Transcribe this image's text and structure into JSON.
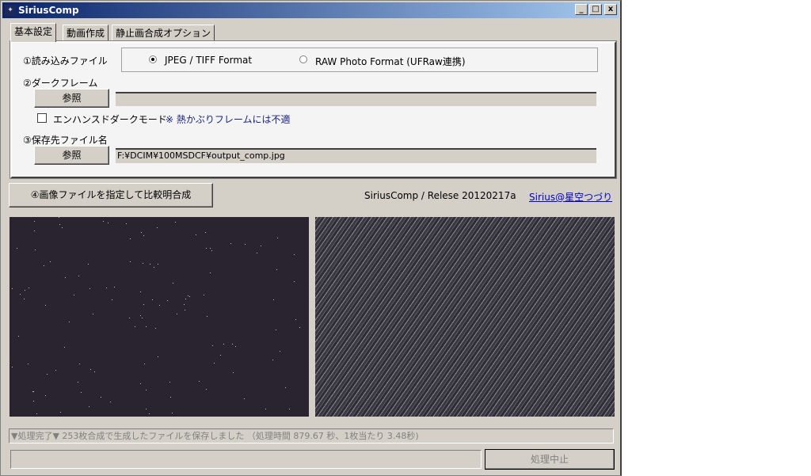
{
  "window": {
    "title": "SiriusComp",
    "minimize": "_",
    "maximize": "□",
    "close": "x"
  },
  "tabs": [
    {
      "label": "基本設定"
    },
    {
      "label": "動画作成"
    },
    {
      "label": "静止画合成オプション"
    }
  ],
  "input": {
    "label": "①読み込みファイル",
    "options": [
      {
        "label": "JPEG / TIFF Format",
        "selected": true
      },
      {
        "label": "RAW Photo Format (UFRaw連携)",
        "selected": false
      }
    ]
  },
  "dark": {
    "label": "②ダークフレーム",
    "browse": "参照",
    "path": "",
    "enhanced_label": "エンハンスドダークモード",
    "enhanced_checked": false,
    "note": "※ 熱かぶりフレームには不適"
  },
  "output": {
    "label": "③保存先ファイル名",
    "browse": "参照",
    "path": "F:¥DCIM¥100MSDCF¥output_comp.jpg"
  },
  "run_button": "④画像ファイルを指定して比較明合成",
  "version": "SiriusComp / Relese 20120217a",
  "link": "Sirius@星空つづり",
  "status": "▼処理完了▼  253枚合成で生成したファイルを保存しました （処理時間 879.67 秒、1枚当たり 3.48秒)",
  "progress": 0,
  "stop_button": "処理中止"
}
